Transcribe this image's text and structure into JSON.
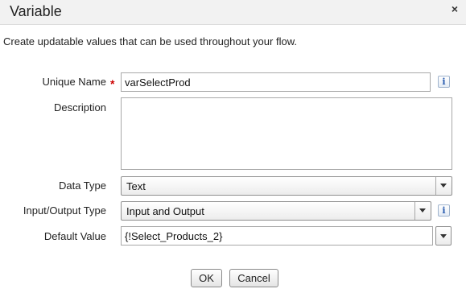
{
  "dialog": {
    "title": "Variable",
    "close_glyph": "×",
    "intro": "Create updatable values that can be used throughout your flow."
  },
  "form": {
    "unique_name": {
      "label": "Unique Name",
      "required_marker": "*",
      "value": "varSelectProd"
    },
    "description": {
      "label": "Description",
      "value": ""
    },
    "data_type": {
      "label": "Data Type",
      "selected": "Text"
    },
    "io_type": {
      "label": "Input/Output Type",
      "selected": "Input and Output"
    },
    "default_value": {
      "label": "Default Value",
      "value": "{!Select_Products_2}"
    },
    "info_glyph": "i"
  },
  "buttons": {
    "ok": "OK",
    "cancel": "Cancel"
  }
}
